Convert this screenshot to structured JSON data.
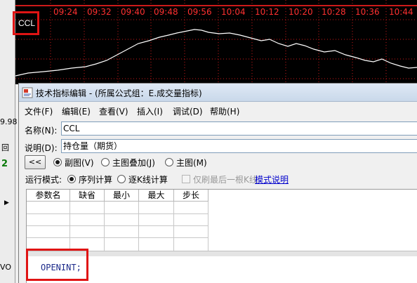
{
  "chart": {
    "indicator_name": "CCL",
    "time_ticks": [
      "09:24",
      "09:32",
      "09:40",
      "09:48",
      "09:56",
      "10:04",
      "10:12",
      "10:20",
      "10:28",
      "10:36",
      "10:44"
    ],
    "colors": {
      "background": "#000000",
      "grid": "#cc1a1a",
      "axis_text": "#ff3030",
      "series": "#ffffff"
    }
  },
  "left_strip": {
    "items": [
      "9.98",
      "回",
      "2",
      "VO"
    ],
    "arrow": "▶"
  },
  "dialog": {
    "title": "技术指标编辑 - (所属公式组：E.成交量指标)",
    "menu": [
      "文件(F)",
      "编辑(E)",
      "查看(V)",
      "插入(I)",
      "调试(D)",
      "帮助(H)"
    ],
    "name_label": "名称(N):",
    "name_value": "CCL",
    "desc_label": "说明(D):",
    "desc_value": "持仓量（期货）",
    "collapse_button": "<<",
    "view_options": [
      {
        "label": "副图(V)",
        "checked": true
      },
      {
        "label": "主图叠加(J)",
        "checked": false
      },
      {
        "label": "主图(M)",
        "checked": false
      }
    ],
    "run_mode_label": "运行模式:",
    "run_options": [
      {
        "label": "序列计算",
        "checked": true
      },
      {
        "label": "逐K线计算",
        "checked": false
      }
    ],
    "refresh_last_only": {
      "label": "仅刷最后一根K线",
      "checked": false,
      "disabled": true
    },
    "mode_help_link": "模式说明",
    "param_columns": [
      "参数名",
      "缺省",
      "最小",
      "最大",
      "步长"
    ],
    "code": "OPENINT;"
  }
}
